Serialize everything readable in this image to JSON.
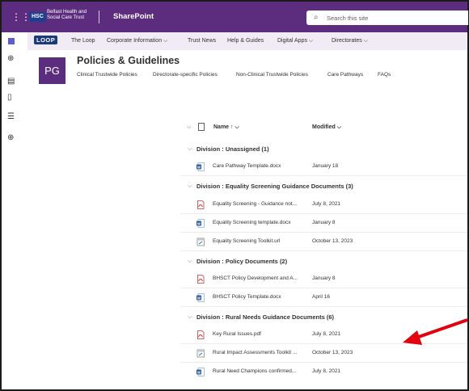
{
  "topbar": {
    "waffle_glyph": "⋮⋮⋮",
    "badge": "HSC",
    "org_line1": "Belfast Health and",
    "org_line2": "Social Care Trust",
    "app_name": "SharePoint",
    "search_placeholder": "Search this site",
    "color": "#5c2d7e"
  },
  "navbar": {
    "logo": "LOOP",
    "items": [
      {
        "label": "The Loop"
      },
      {
        "label": "Corporate Information ⌵"
      },
      {
        "label": "Trust News"
      },
      {
        "label": "Help & Guides"
      },
      {
        "label": "Digital Apps ⌵"
      },
      {
        "label": "Directorates ⌵"
      }
    ]
  },
  "site": {
    "logo_text": "PG",
    "title": "Policies & Guidelines",
    "links": [
      "Clinical Trustwide Policies",
      "Directorate-specific Policies",
      "Non-Clinical Trustwide Policies",
      "Care Pathways",
      "FAQs"
    ]
  },
  "rail_icons": [
    "teams-icon",
    "globe-icon",
    "news-icon",
    "document-icon",
    "list-icon",
    "add-icon"
  ],
  "columns": {
    "name": "Name ↑ ⌵",
    "modified": "Modified ⌵"
  },
  "groups": [
    {
      "label": "Division : Unassigned (1)",
      "files": [
        {
          "name": "Care Pathway Template.docx",
          "modified": "January 18",
          "type": "word"
        }
      ]
    },
    {
      "label": "Division : Equality Screening Guidance Documents (3)",
      "files": [
        {
          "name": "Equality Screening - Guidance not...",
          "modified": "July 8, 2021",
          "type": "pdf"
        },
        {
          "name": "Equality Screening template.docx",
          "modified": "January 8",
          "type": "word"
        },
        {
          "name": "Equality Screening Toolkit.url",
          "modified": "October 13, 2023",
          "type": "url"
        }
      ]
    },
    {
      "label": "Division : Policy Documents (2)",
      "files": [
        {
          "name": "BHSCT Policy Development and A...",
          "modified": "January 8",
          "type": "pdf"
        },
        {
          "name": "BHSCT Policy Template.docx",
          "modified": "April 16",
          "type": "word"
        }
      ]
    },
    {
      "label": "Division : Rural Needs Guidance Documents (6)",
      "files": [
        {
          "name": "Key Rural Issues.pdf",
          "modified": "July 8, 2021",
          "type": "pdf"
        },
        {
          "name": "Rural Impact Assessments Toolkit ...",
          "modified": "October 13, 2023",
          "type": "url"
        },
        {
          "name": "Rural Need Champions confirmed...",
          "modified": "July 8, 2021",
          "type": "word"
        }
      ]
    }
  ],
  "annotation": {
    "arrow_color": "#e3000f"
  }
}
